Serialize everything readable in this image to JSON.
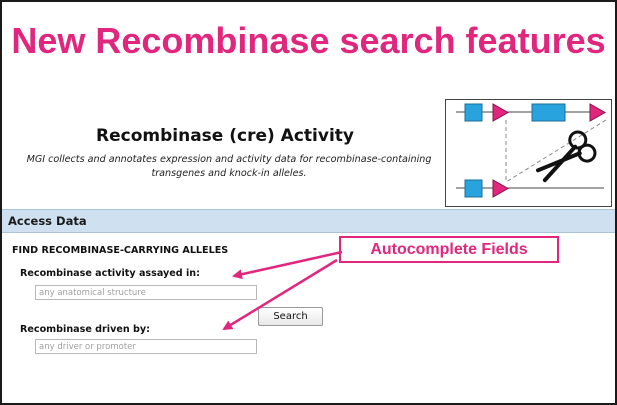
{
  "headline": "New Recombinase search features",
  "page": {
    "title": "Recombinase (cre) Activity",
    "description_line1": "MGI collects and annotates expression and activity data for recombinase-containing",
    "description_line2": "transgenes and knock-in alleles."
  },
  "access_data": {
    "label": "Access Data"
  },
  "form": {
    "section_title": "FIND RECOMBINASE-CARRYING ALLELES",
    "activity_label": "Recombinase activity assayed in:",
    "activity_placeholder": "any anatomical structure",
    "activity_value": "",
    "driver_label": "Recombinase driven by:",
    "driver_placeholder": "any driver or promoter",
    "driver_value": "",
    "search_label": "Search"
  },
  "callout": {
    "label": "Autocomplete Fields"
  },
  "colors": {
    "accent": "#e0277d",
    "bar": "#cfe0f0",
    "logo_box": "#29a3dd",
    "logo_arrow": "#e0277d"
  },
  "icons": {
    "logo": "recombinase-scissors-logo"
  }
}
